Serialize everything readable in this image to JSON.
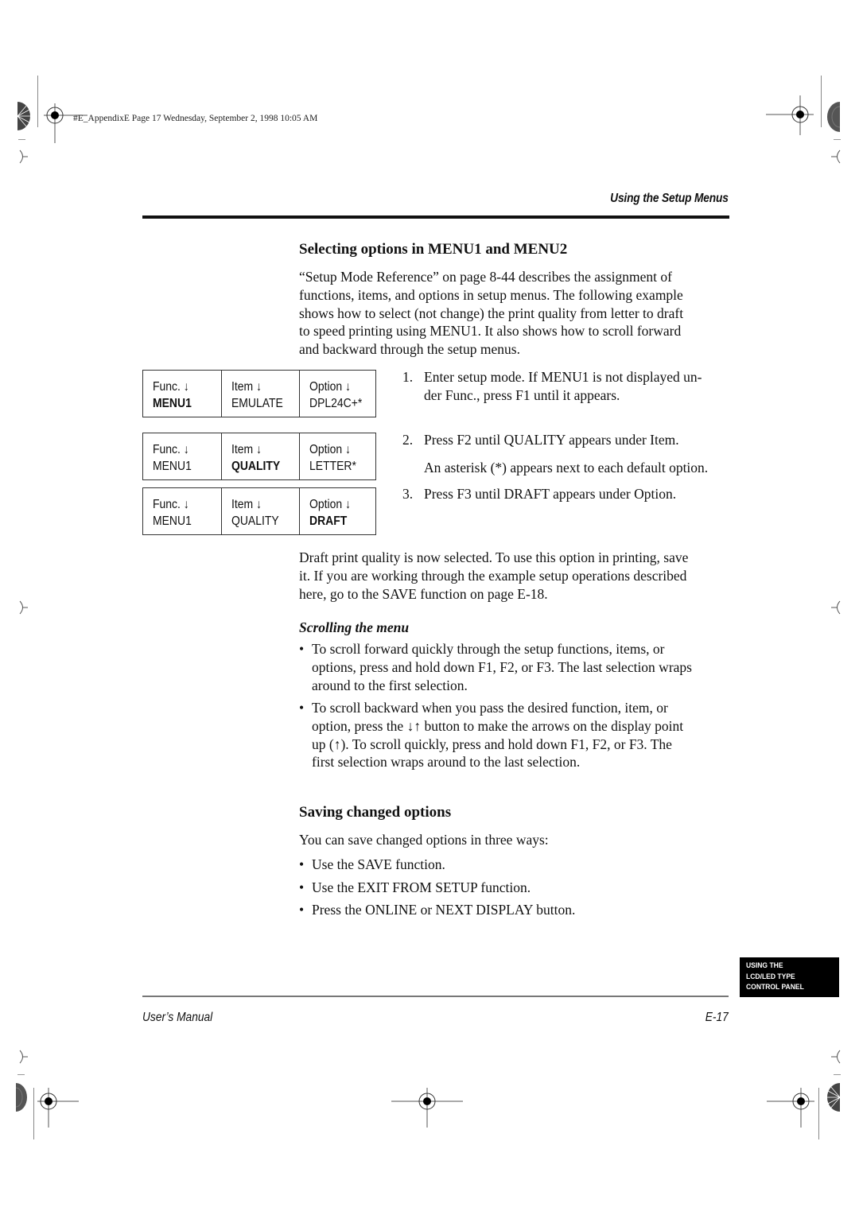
{
  "print_stamp": "#E_AppendixE  Page 17  Wednesday, September 2, 1998  10:05 AM",
  "running_head": "Using the Setup Menus",
  "section1": {
    "heading": "Selecting options in MENU1 and MENU2",
    "intro_lines": [
      "“Setup Mode Reference” on page 8-44 describes the assignment of",
      "functions, items, and options in setup menus. The following example",
      "shows how to select (not change) the print quality from letter to draft",
      "to speed printing using MENU1. It also shows how to scroll forward",
      "and backward through the setup menus."
    ]
  },
  "lcd_displays": [
    {
      "func_label": "Func. ↓",
      "func_value": "MENU1",
      "item_label": "Item ↓",
      "item_value": "EMULATE",
      "option_label": "Option ↓",
      "option_value": "DPL24C+*",
      "bold_field": "func"
    },
    {
      "func_label": "Func. ↓",
      "func_value": "MENU1",
      "item_label": "Item ↓",
      "item_value": "QUALITY",
      "option_label": "Option ↓",
      "option_value": "LETTER*",
      "bold_field": "item"
    },
    {
      "func_label": "Func. ↓",
      "func_value": "MENU1",
      "item_label": "Item ↓",
      "item_value": "QUALITY",
      "option_label": "Option ↓",
      "option_value": "DRAFT",
      "bold_field": "option"
    }
  ],
  "steps": [
    {
      "num": "1.",
      "lines": [
        "Enter setup mode. If MENU1 is not displayed un-",
        "der Func., press F1 until it appears."
      ]
    },
    {
      "num": "2.",
      "lines": [
        "Press F2 until QUALITY appears under Item."
      ],
      "note": "An asterisk (*) appears next to each default option."
    },
    {
      "num": "3.",
      "lines": [
        "Press F3 until DRAFT appears under Option."
      ]
    }
  ],
  "draft_paragraph_lines": [
    "Draft print quality is now selected. To use this option in printing, save",
    "it. If you are working through the example setup operations described",
    "here, go to the SAVE function on page E-18."
  ],
  "scrolling": {
    "subheading": "Scrolling the menu",
    "bullets": [
      {
        "lines": [
          "To scroll forward quickly through the setup functions, items, or",
          "options, press and hold down F1, F2, or F3. The last selection wraps",
          "around to the first selection."
        ]
      },
      {
        "lines": [
          "To scroll backward when you pass the desired function, item, or",
          "option, press the ↓↑ button to make the arrows on the display point",
          "up (↑). To scroll quickly, press and hold down F1, F2, or F3. The",
          "first selection wraps around to the last selection."
        ]
      }
    ]
  },
  "section2": {
    "heading": "Saving changed options",
    "intro": "You can save changed options in three ways:",
    "bullets": [
      "Use the SAVE function.",
      "Use the EXIT FROM SETUP function.",
      "Press the ONLINE or NEXT DISPLAY button."
    ]
  },
  "bullet_char": "•",
  "side_tab": [
    "USING THE",
    "LCD/LED TYPE",
    "CONTROL PANEL"
  ],
  "footer": {
    "left": "User’s Manual",
    "right": "E-17"
  }
}
